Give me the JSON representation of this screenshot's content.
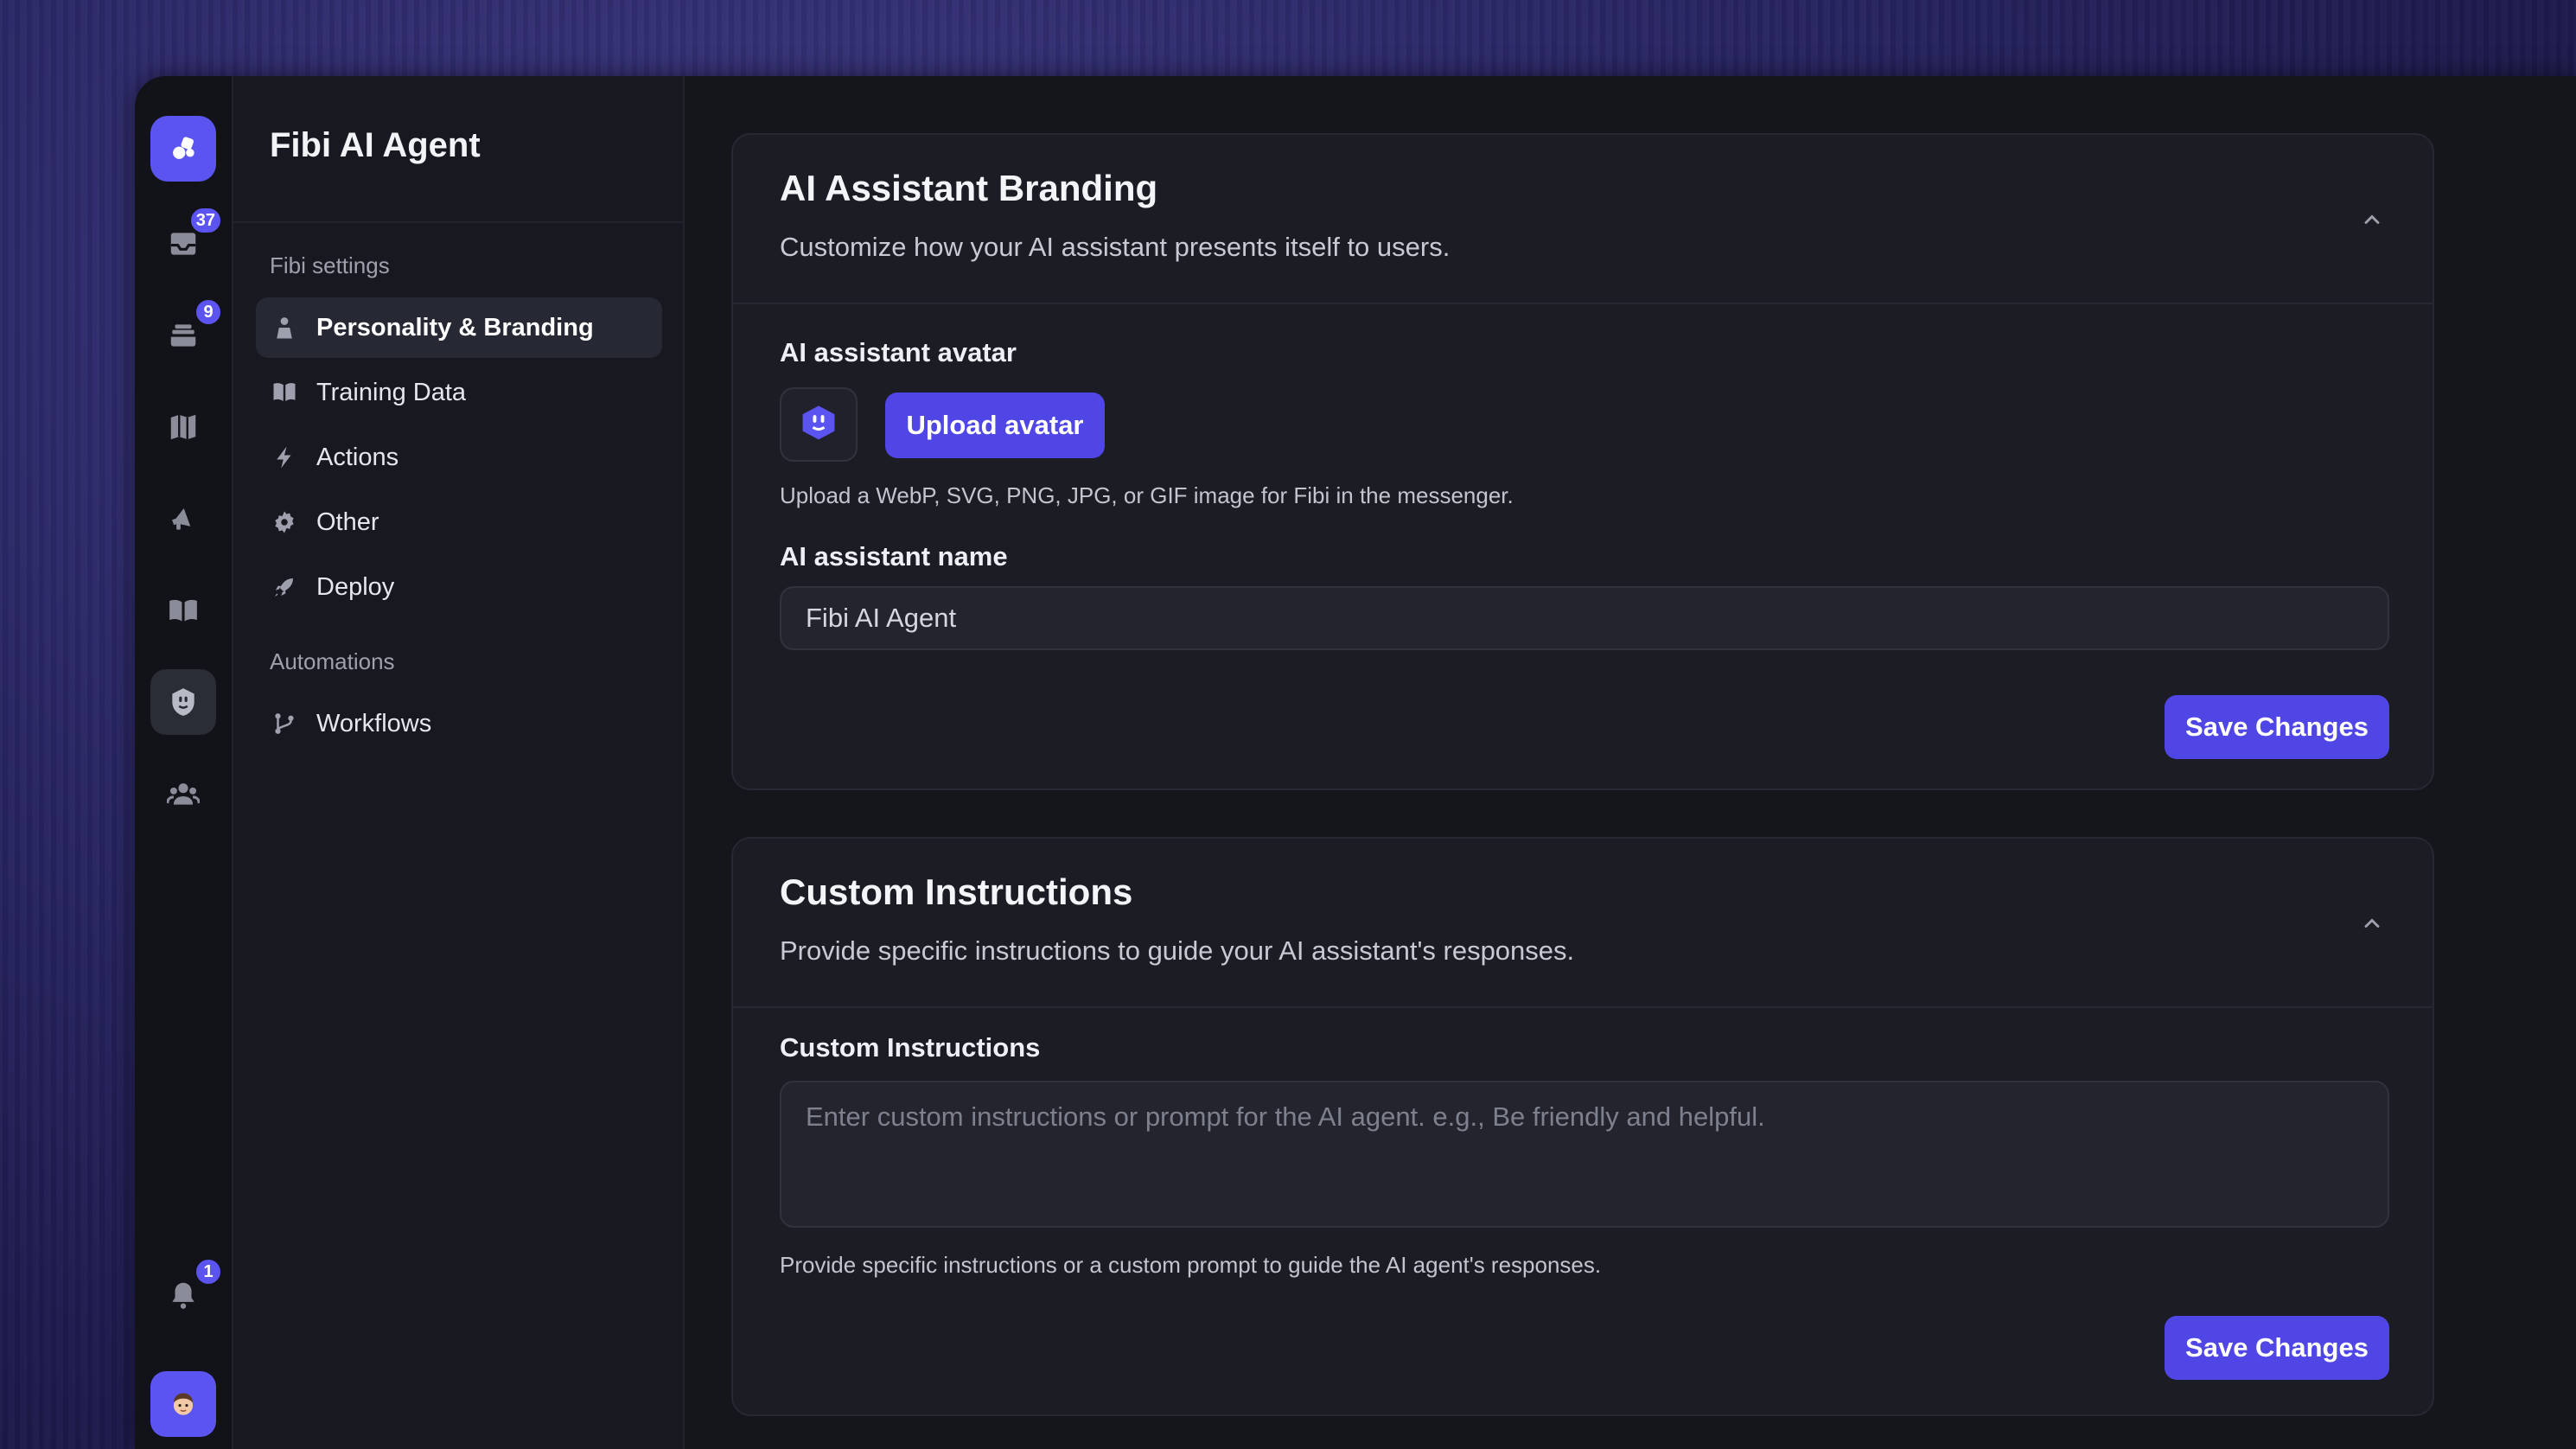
{
  "rail": {
    "inbox_badge": "37",
    "tickets_badge": "9",
    "notifications_badge": "1"
  },
  "sidebar": {
    "title": "Fibi AI Agent",
    "section_fibi": "Fibi settings",
    "items": [
      {
        "label": "Personality & Branding",
        "icon": "person-icon"
      },
      {
        "label": "Training Data",
        "icon": "book-icon"
      },
      {
        "label": "Actions",
        "icon": "bolt-icon"
      },
      {
        "label": "Other",
        "icon": "gear-icon"
      },
      {
        "label": "Deploy",
        "icon": "rocket-icon"
      }
    ],
    "section_automations": "Automations",
    "automation_items": [
      {
        "label": "Workflows",
        "icon": "branch-icon"
      }
    ]
  },
  "branding": {
    "title": "AI Assistant Branding",
    "description": "Customize how your AI assistant presents itself to users.",
    "avatar_label": "AI assistant avatar",
    "upload_button": "Upload avatar",
    "avatar_help": "Upload a WebP, SVG, PNG, JPG, or GIF image for Fibi in the messenger.",
    "name_label": "AI assistant name",
    "name_value": "Fibi AI Agent",
    "save_button": "Save Changes"
  },
  "instructions": {
    "title": "Custom Instructions",
    "description": "Provide specific instructions to guide your AI assistant's responses.",
    "field_label": "Custom Instructions",
    "placeholder": "Enter custom instructions or prompt for the AI agent. e.g., Be friendly and helpful.",
    "help": "Provide specific instructions or a custom prompt to guide the AI agent's responses.",
    "save_button": "Save Changes"
  },
  "colors": {
    "accent": "#4f46e5",
    "background": "#15161c",
    "card": "#1b1c24"
  }
}
